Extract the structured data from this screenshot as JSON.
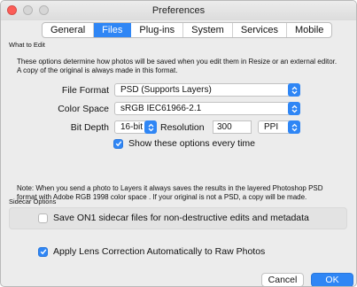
{
  "window": {
    "title": "Preferences"
  },
  "tabs": [
    {
      "label": "General"
    },
    {
      "label": "Files"
    },
    {
      "label": "Plug-ins"
    },
    {
      "label": "System"
    },
    {
      "label": "Services"
    },
    {
      "label": "Mobile"
    }
  ],
  "active_tab": "Files",
  "what_to_edit": {
    "section_label": "What to Edit",
    "description": "These options determine how photos will be saved when you edit them in Resize or an external editor. A copy of the original is always made in this format.",
    "file_format_label": "File Format",
    "file_format_value": "PSD (Supports Layers)",
    "color_space_label": "Color Space",
    "color_space_value": "sRGB IEC61966-2.1",
    "bit_depth_label": "Bit Depth",
    "bit_depth_value": "16-bit",
    "resolution_label": "Resolution",
    "resolution_value": "300",
    "resolution_unit": "PPI",
    "show_options_label": "Show these options every time",
    "show_options_checked": true,
    "note": "Note: When you send a photo to Layers it always saves the results in the layered Photoshop PSD format with Adobe RGB 1998 color space . If your original is not a PSD, a copy will be made."
  },
  "sidecar": {
    "section_label": "Sidecar Options",
    "save_sidecar_label": "Save ON1 sidecar files for non-destructive edits and metadata",
    "save_sidecar_checked": false
  },
  "lens_correction": {
    "label": "Apply Lens Correction Automatically to Raw Photos",
    "checked": true
  },
  "buttons": {
    "cancel": "Cancel",
    "ok": "OK"
  },
  "colors": {
    "accent": "#2f86f5",
    "panel": "#e3e3e3",
    "window": "#ececec"
  }
}
